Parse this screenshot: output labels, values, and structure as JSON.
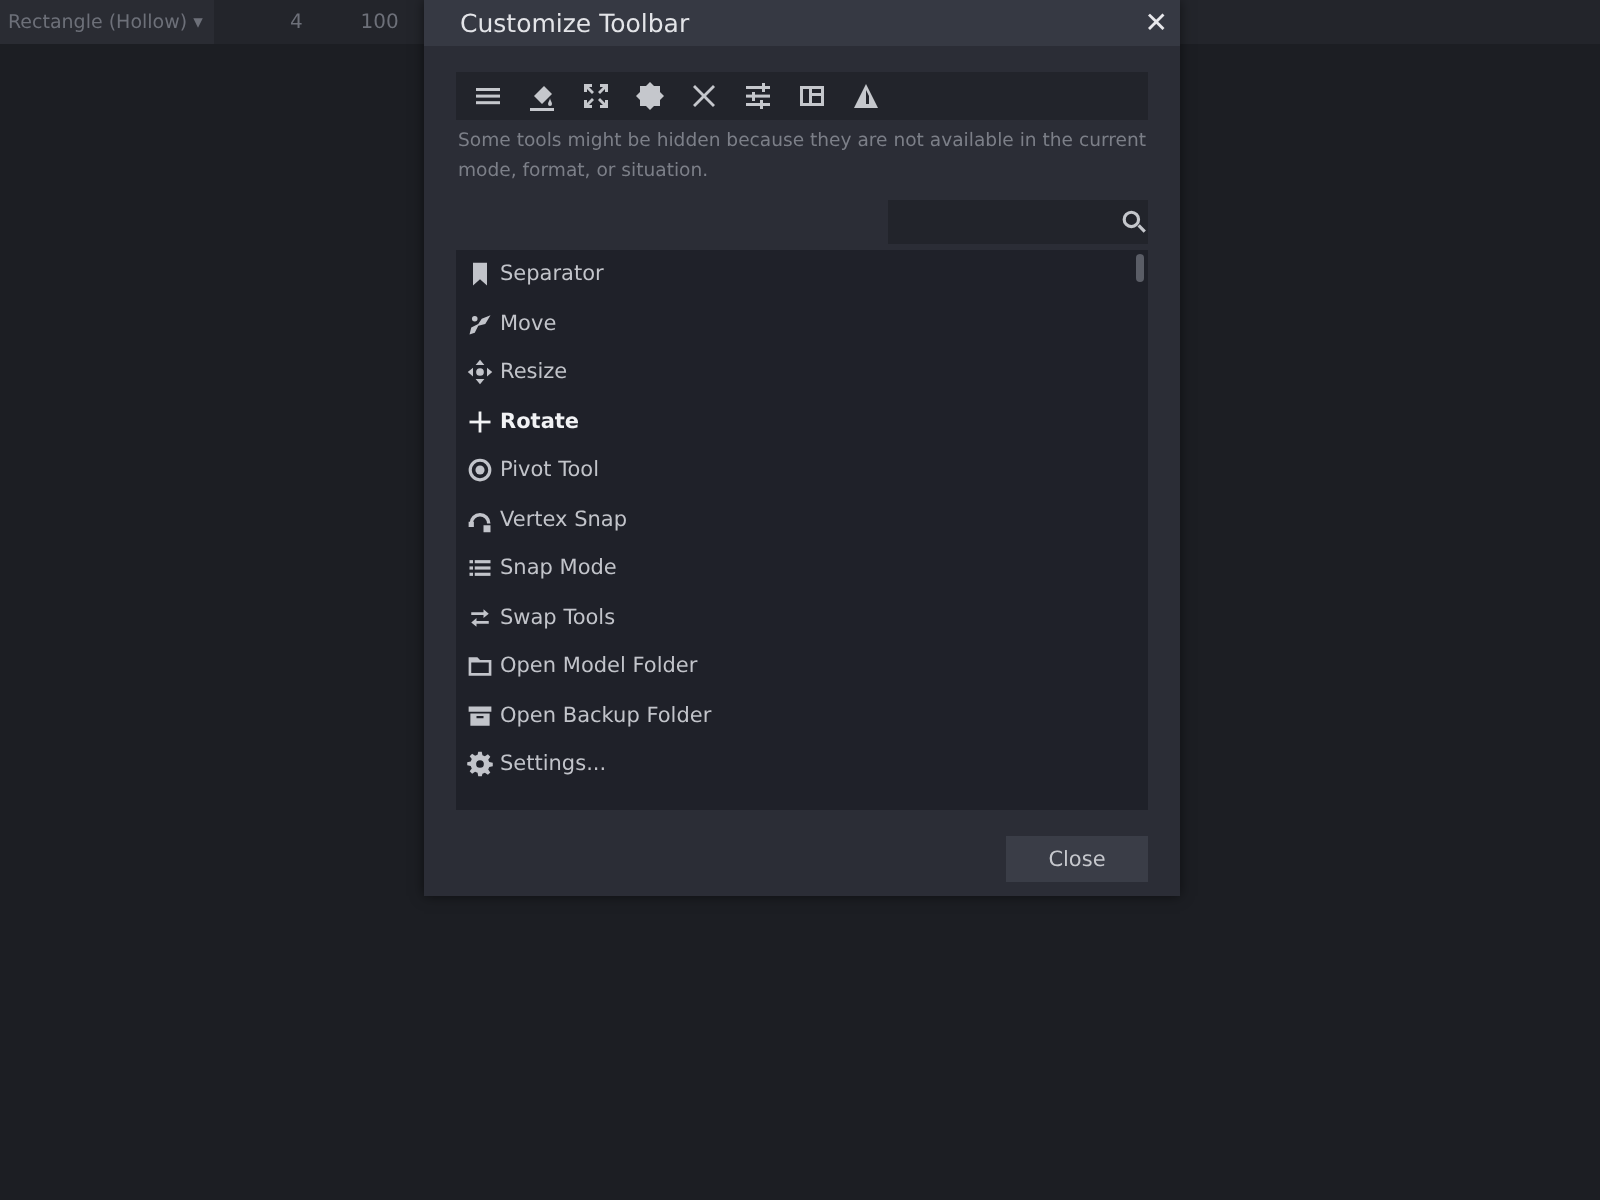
{
  "top_bar": {
    "shape_dropdown": "Rectangle (Hollow)",
    "caret": "▾",
    "field_1": "4",
    "field_2": "100"
  },
  "dialog": {
    "title": "Customize Toolbar",
    "close_glyph": "✕",
    "note": "Some tools might be hidden because they are not available in the current mode, format, or situation.",
    "items": [
      {
        "label": "Separator",
        "highlighted": false
      },
      {
        "label": "Move",
        "highlighted": false
      },
      {
        "label": "Resize",
        "highlighted": false
      },
      {
        "label": "Rotate",
        "highlighted": true
      },
      {
        "label": "Pivot Tool",
        "highlighted": false
      },
      {
        "label": "Vertex Snap",
        "highlighted": false
      },
      {
        "label": "Snap Mode",
        "highlighted": false
      },
      {
        "label": "Swap Tools",
        "highlighted": false
      },
      {
        "label": "Open Model Folder",
        "highlighted": false
      },
      {
        "label": "Open Backup Folder",
        "highlighted": false
      },
      {
        "label": "Settings...",
        "highlighted": false
      }
    ],
    "close_button": "Close"
  }
}
